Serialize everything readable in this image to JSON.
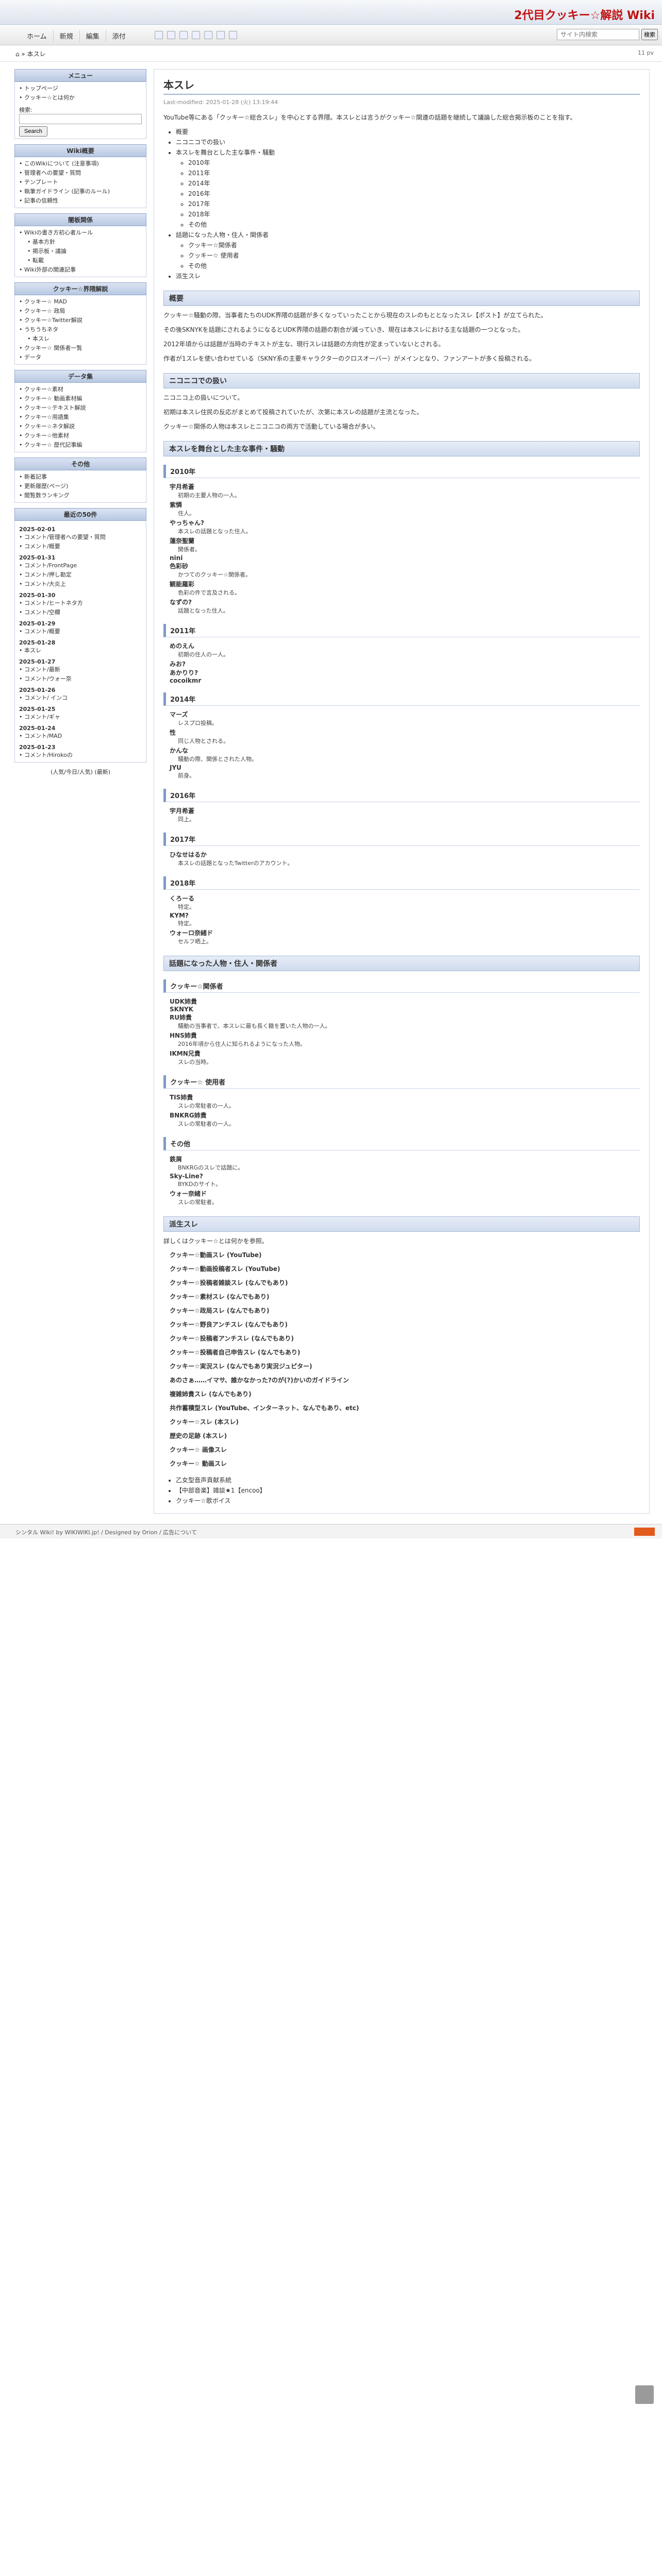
{
  "header": {
    "site_title": "2代目クッキー☆解説 Wiki"
  },
  "nav": {
    "items": [
      "ホーム",
      "新規",
      "編集",
      "添付"
    ],
    "search_placeholder": "サイト内検索",
    "search_btn": "検索"
  },
  "crumb": "⌂ » 本スレ",
  "pageinfo": "11 pv",
  "side": {
    "menu": "メニュー",
    "menu_items": [
      "トップページ",
      "クッキー☆とは何か"
    ],
    "search_label": "検索:",
    "search_btn": "Search",
    "wiki_title": "Wiki概要",
    "wiki_items": [
      "このWikiについて (注意事項)",
      "管理者への要望・質問",
      "テンプレート",
      "執筆ガイドライン (記事のルール)",
      "記事の信頼性"
    ],
    "ref_title": "闇板関係",
    "ref_items": [
      "Wikiの書き方初心者ルール",
      "基本方針",
      "掲示板・議論",
      "転載",
      "Wiki外部の関連記事"
    ],
    "cookie_title": "クッキー☆界隈解説",
    "cookie_items": [
      "クッキー☆ MAD",
      "クッキー☆ 政局",
      "クッキー☆Twitter解説",
      "うちうちネタ",
      "本スレ",
      "クッキー☆ 関係者一覧",
      "データ"
    ],
    "data_title": "データ集",
    "data_items": [
      "クッキー☆素材",
      "クッキー☆ 動画素材編",
      "クッキー☆テキスト解説",
      "クッキー☆用語集",
      "クッキー☆ネタ解説",
      "クッキー☆他素材",
      "クッキー☆ 歴代記事編"
    ],
    "other_title": "その他",
    "other_items": [
      "新着記事",
      "更新履歴(ページ)",
      "閲覧数ランキング"
    ],
    "recent_title": "最近の50件",
    "recent": [
      {
        "date": "2025-02-01",
        "items": [
          "コメント/管理者への要望・質問",
          "コメント/概要"
        ]
      },
      {
        "date": "2025-01-31",
        "items": [
          "コメント/FrontPage",
          "コメント/押し勘定",
          "コメント/大炎上"
        ]
      },
      {
        "date": "2025-01-30",
        "items": [
          "コメント/ヒートネタ方",
          "コメント/空欄"
        ]
      },
      {
        "date": "2025-01-29",
        "items": [
          "コメント/概要"
        ]
      },
      {
        "date": "2025-01-28",
        "items": [
          "本スレ"
        ]
      },
      {
        "date": "2025-01-27",
        "items": [
          "コメント/最新",
          "コメント/ウォー奈"
        ]
      },
      {
        "date": "2025-01-26",
        "items": [
          "コメント/ インコ"
        ]
      },
      {
        "date": "2025-01-25",
        "items": [
          "コメント/ギャ"
        ]
      },
      {
        "date": "2025-01-24",
        "items": [
          "コメント/MAD"
        ]
      },
      {
        "date": "2025-01-23",
        "items": [
          "コメント/Hirokoの"
        ]
      }
    ],
    "counter": "(人気/今日/人気) (最新)"
  },
  "main": {
    "title": "本スレ",
    "lastmod": "Last-modified: 2025-01-28 (火) 13:19:44",
    "intro": "YouTube等にある「クッキー☆総合スレ」を中心とする界隈。本スレとは言うがクッキー☆関連の話題を継続して議論した総合掲示板のことを指す。",
    "toc": [
      "概要",
      "ニコニコでの扱い",
      "本スレを舞台とした主な事件・騒動",
      "2010年",
      "2011年",
      "2014年",
      "2016年",
      "2017年",
      "2018年",
      "その他",
      "話題になった人物・住人・関係者",
      "クッキー☆関係者",
      "クッキー☆ 使用者",
      "その他",
      "派生スレ"
    ],
    "sections": [
      {
        "h": "概要",
        "paras": [
          "クッキー☆騒動の際、当事者たちのUDK界隈の話題が多くなっていったことから現在のスレのもととなったスレ【ポスト】が立てられた。",
          "その後SKNYKを話題にされるようになるとUDK界隈の話題の割合が減っていき、現在は本スレにおける主な話題の一つとなった。",
          "2012年頃からは話題が当時のテキストが主な、現行スレは話題の方向性が定まっていないとされる。",
          "作者が1スレを使い合わせている（SKNY系の主要キャラクターのクロスオーバー）がメインとなり、ファンアートが多く投稿される。"
        ]
      },
      {
        "h": "ニコニコでの扱い",
        "paras": [
          "ニコニコ上の扱いについて。",
          "初期は本スレ住民の反応がまとめて投稿されていたが、次第に本スレの話題が主流となった。",
          "クッキー☆関係の人物は本スレとニコニコの両方で活動している場合が多い。"
        ]
      },
      {
        "h": "本スレを舞台とした主な事件・騒動",
        "paras": []
      },
      {
        "h": "話題になった人物・住人・関係者",
        "paras": []
      },
      {
        "h": "派生スレ",
        "paras": [
          "詳しくはクッキー☆とは何かを参照。"
        ]
      }
    ],
    "events": [
      {
        "year": "2010年",
        "entries": [
          {
            "n": "宇月希蒼",
            "d": "初期の主要人物の一人。"
          },
          {
            "n": "紫憐",
            "d": "住人。"
          },
          {
            "n": "やっちゃん?",
            "d": "本スレの話題となった住人。"
          },
          {
            "n": "蓮奈聖蘭",
            "d": "関係者。"
          },
          {
            "n": "nini",
            "d": ""
          },
          {
            "n": "色彩砂",
            "d": "かつてのクッキー☆関係者。"
          },
          {
            "n": "観能羅彩",
            "d": "色彩の件で言及される。"
          },
          {
            "n": "なずの?",
            "d": "話題となった住人。"
          }
        ]
      },
      {
        "year": "2011年",
        "entries": [
          {
            "n": "めのえん",
            "d": "初期の住人の一人。"
          },
          {
            "n": "みお?",
            "d": ""
          },
          {
            "n": "あかりり?",
            "d": ""
          },
          {
            "n": "cocoikmr",
            "d": ""
          }
        ]
      },
      {
        "year": "2014年",
        "entries": [
          {
            "n": "マーズ",
            "d": "レスプロ投稿。"
          },
          {
            "n": "性",
            "d": "同じ人物とされる。"
          },
          {
            "n": "かんな",
            "d": "騒動の際、関係とされた人物。"
          },
          {
            "n": "JYU",
            "d": "前身。"
          }
        ]
      },
      {
        "year": "2016年",
        "entries": [
          {
            "n": "宇月希蒼",
            "d": "同上。"
          }
        ]
      },
      {
        "year": "2017年",
        "entries": [
          {
            "n": "ひなせはるか",
            "d": "本スレの話題となったTwitterのアカウント。"
          }
        ]
      },
      {
        "year": "2018年",
        "entries": [
          {
            "n": "くろーる",
            "d": "特定。"
          },
          {
            "n": "KYM?",
            "d": "特定。"
          },
          {
            "n": "ウォーロ奈緒ド",
            "d": "セルフ晒上。"
          }
        ]
      }
    ],
    "people": [
      {
        "group": "クッキー☆関係者",
        "entries": [
          {
            "n": "UDK姉貴",
            "d": ""
          },
          {
            "n": "SKNYK",
            "d": ""
          },
          {
            "n": "RU姉貴",
            "d": "騒動の当事者で、本スレに最も長く籍を置いた人物の一人。"
          },
          {
            "n": "HNS姉貴",
            "d": "2016年頃から住人に知られるようになった人物。"
          },
          {
            "n": "IKMN兄貴",
            "d": "スレの当時。"
          }
        ]
      },
      {
        "group": "クッキー☆ 使用者",
        "entries": [
          {
            "n": "TIS姉貴",
            "d": "スレの常駐者の一人。"
          },
          {
            "n": "BNKRG姉貴",
            "d": "スレの常駐者の一人。"
          }
        ]
      },
      {
        "group": "その他",
        "entries": [
          {
            "n": "鉄屑",
            "d": "BNKRGのスレで話題に。"
          },
          {
            "n": "Sky-Line?",
            "d": "BYKDのサイト。"
          },
          {
            "n": "ウォー奈緒ド",
            "d": "スレの常駐者。"
          }
        ]
      }
    ],
    "derived": [
      "クッキー☆動画スレ (YouTube)",
      "クッキー☆動画投稿者スレ (YouTube)",
      "クッキー☆投稿者雑談スレ (なんでもあり)",
      "クッキー☆素材スレ (なんでもあり)",
      "クッキー☆政局スレ (なんでもあり)",
      "クッキー☆野良アンチスレ (なんでもあり)",
      "クッキー☆投稿者アンチスレ (なんでもあり)",
      "クッキー☆投稿者自己申告スレ (なんでもあり)",
      "クッキー☆実況スレ (なんでもあり実況ジュピター)",
      "あのさぁ……イマサ、誰かなかった?のが(?)かいのガイドライン",
      "複雑姉貴スレ (なんでもあり)",
      "共作蓄積型スレ (YouTube、インターネット、なんでもあり、etc)",
      "クッキー☆スレ (本スレ)",
      "歴史の足跡 (本スレ)",
      "クッキー☆ 画像スレ",
      "クッキー☆ 動画スレ"
    ],
    "bottom_links": [
      "乙女型音声貢献系統",
      "【中部音楽】雑談★1【encoo】",
      "クッキー☆歌ボイス"
    ]
  },
  "footer": "シンタル Wiki! by WIKIWIKI.jp! / Designed by Orion / 広告について"
}
